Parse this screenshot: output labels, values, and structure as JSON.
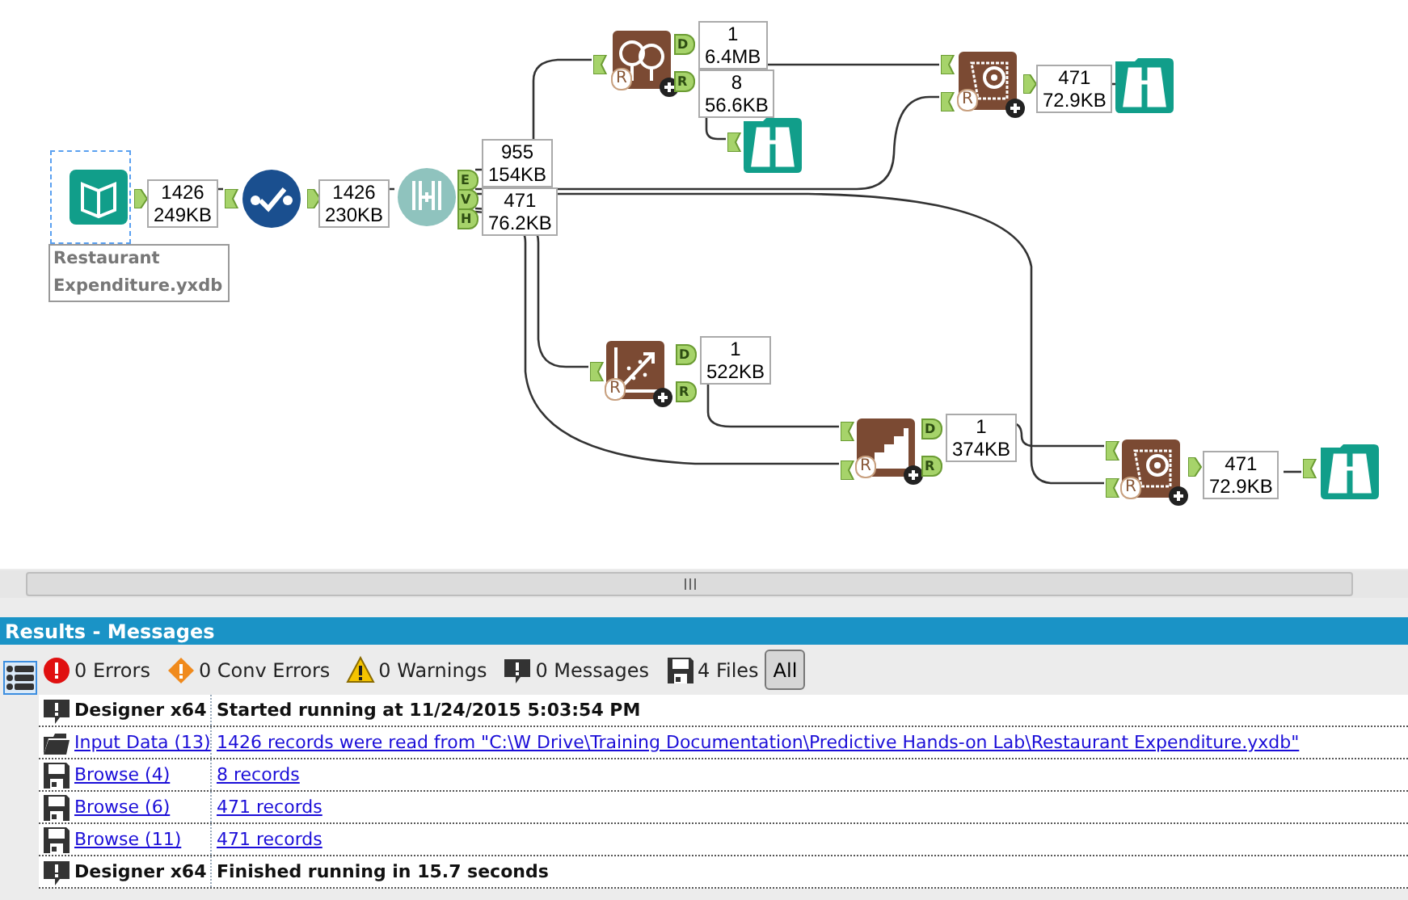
{
  "canvas": {
    "tools": [
      {
        "kind": "input",
        "selected": true,
        "label": "Restaurant Expenditure.yxdb"
      },
      {
        "kind": "select",
        "selected": false
      },
      {
        "kind": "samples",
        "selected": false,
        "outputs": [
          "E",
          "V",
          "H"
        ]
      },
      {
        "kind": "forest",
        "selected": false,
        "badge": "R",
        "outputs": [
          "D",
          "R"
        ]
      },
      {
        "kind": "browse",
        "selected": false
      },
      {
        "kind": "score",
        "selected": false,
        "badge": "R"
      },
      {
        "kind": "browse",
        "selected": false
      },
      {
        "kind": "linear",
        "selected": false,
        "badge": "R",
        "outputs": [
          "D",
          "R"
        ]
      },
      {
        "kind": "stepwise",
        "selected": false,
        "badge": "R",
        "outputs": [
          "D",
          "R"
        ]
      },
      {
        "kind": "score",
        "selected": false,
        "badge": "R"
      },
      {
        "kind": "browse",
        "selected": false
      }
    ],
    "counts": [
      {
        "records": "1426",
        "size": "249KB"
      },
      {
        "records": "1426",
        "size": "230KB"
      },
      {
        "records": "955",
        "size": "154KB"
      },
      {
        "records": "471",
        "size": "76.2KB"
      },
      {
        "records": "1",
        "size": "6.4MB"
      },
      {
        "records": "8",
        "size": "56.6KB"
      },
      {
        "records": "471",
        "size": "72.9KB"
      },
      {
        "records": "1",
        "size": "522KB"
      },
      {
        "records": "1",
        "size": "374KB"
      },
      {
        "records": "471",
        "size": "72.9KB"
      }
    ]
  },
  "results": {
    "title": "Results - Messages",
    "list_view": {
      "selected": true
    },
    "filters": [
      {
        "kind": "error",
        "label": "0 Errors"
      },
      {
        "kind": "conv",
        "label": "0 Conv Errors"
      },
      {
        "kind": "warning",
        "label": "0 Warnings"
      },
      {
        "kind": "message",
        "label": "0 Messages"
      },
      {
        "kind": "file",
        "label": "4 Files"
      }
    ],
    "all_button": {
      "label": "All",
      "selected": true
    },
    "rows": [
      {
        "kind": "message",
        "tool": "Designer x64",
        "text": "Started running  at 11/24/2015 5:03:54 PM",
        "link": false
      },
      {
        "kind": "input",
        "tool": "Input Data (13)",
        "text": "1426 records were read from \"C:\\W Drive\\Training Documentation\\Predictive Hands-on Lab\\Restaurant Expenditure.yxdb\"",
        "link": true
      },
      {
        "kind": "file",
        "tool": "Browse (4)",
        "text": "8 records",
        "link": true
      },
      {
        "kind": "file",
        "tool": "Browse (6)",
        "text": "471 records",
        "link": true
      },
      {
        "kind": "file",
        "tool": "Browse (11)",
        "text": "471 records",
        "link": true
      },
      {
        "kind": "message",
        "tool": "Designer x64",
        "text": "Finished running  in 15.7 seconds",
        "link": false
      }
    ]
  }
}
